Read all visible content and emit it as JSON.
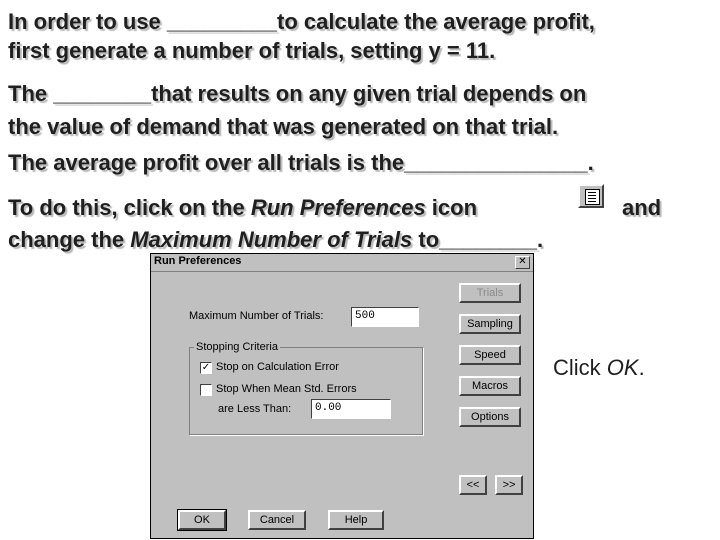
{
  "slide": {
    "line1": "In order to use _________to calculate the average profit,",
    "line2": "first generate a number of trials, setting y = 11.",
    "line3": "The ________that results on any given trial depends on",
    "line4": "the value of demand that was generated on that trial.",
    "line5": "The average profit over all trials is the_______________.",
    "line6_a": "To do this, click on the ",
    "line6_italic": "Run Preferences",
    "line6_b": " icon",
    "line6_c": "and",
    "line7_a": "change the ",
    "line7_italic": "Maximum Number of Trials",
    "line7_b": " to________.",
    "click_a": "Click ",
    "click_italic": "OK",
    "click_b": "."
  },
  "dialog": {
    "title": "Run Preferences",
    "close_glyph": "✕",
    "max_trials_label": "Maximum Number of Trials:",
    "max_trials_value": "500",
    "stopping_criteria_label": "Stopping Criteria",
    "stop_on_error_label": "Stop on Calculation Error",
    "stop_on_error_checked": "✓",
    "stop_mean_label": "Stop When Mean Std. Errors",
    "less_than_label": "are Less Than:",
    "less_than_value": "0.00",
    "buttons": {
      "trials": "Trials",
      "sampling": "Sampling",
      "speed": "Speed",
      "macros": "Macros",
      "options": "Options",
      "prev": "<<",
      "next": ">>",
      "ok": "OK",
      "cancel": "Cancel",
      "help": "Help"
    }
  }
}
